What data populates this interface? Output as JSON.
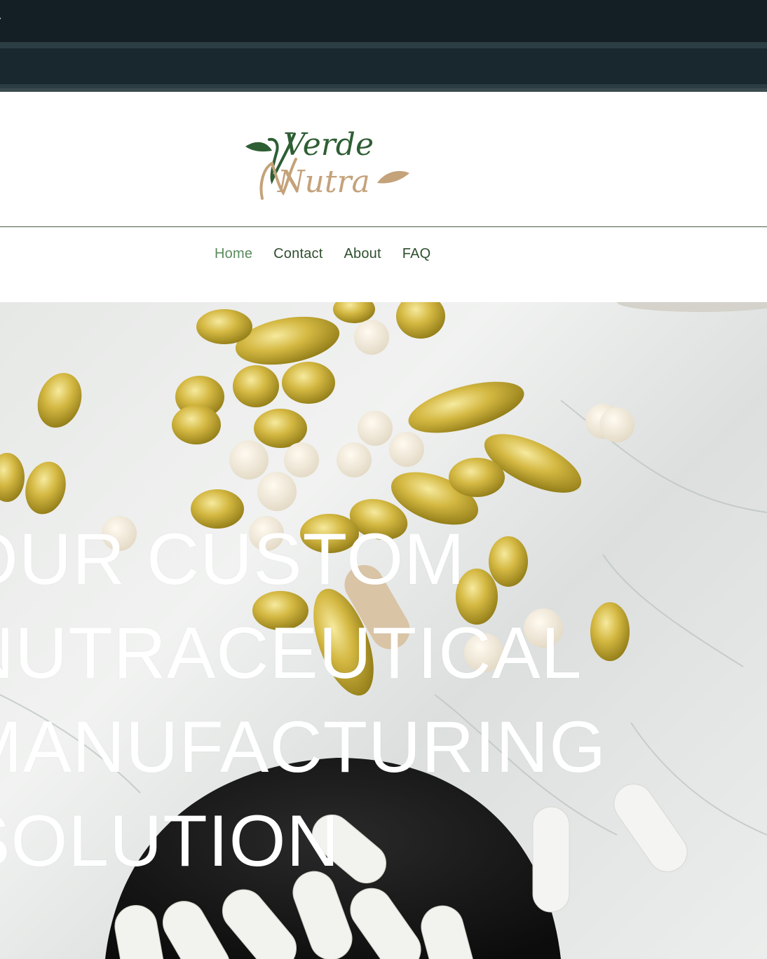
{
  "brand": {
    "logo_word1": "Verde",
    "logo_word2": "Nutra",
    "green": "#2e5e34",
    "tan": "#c4a27a"
  },
  "nav": {
    "items": [
      {
        "label": "Home",
        "active": true
      },
      {
        "label": "Contact",
        "active": false
      },
      {
        "label": "About",
        "active": false
      },
      {
        "label": "FAQ",
        "active": false
      }
    ]
  },
  "hero": {
    "lines": [
      "OUR CUSTOM",
      "NUTRACEUTICAL",
      "MANUFACTURING",
      "SOLUTION"
    ],
    "image": "softgel-capsules-on-marble"
  }
}
